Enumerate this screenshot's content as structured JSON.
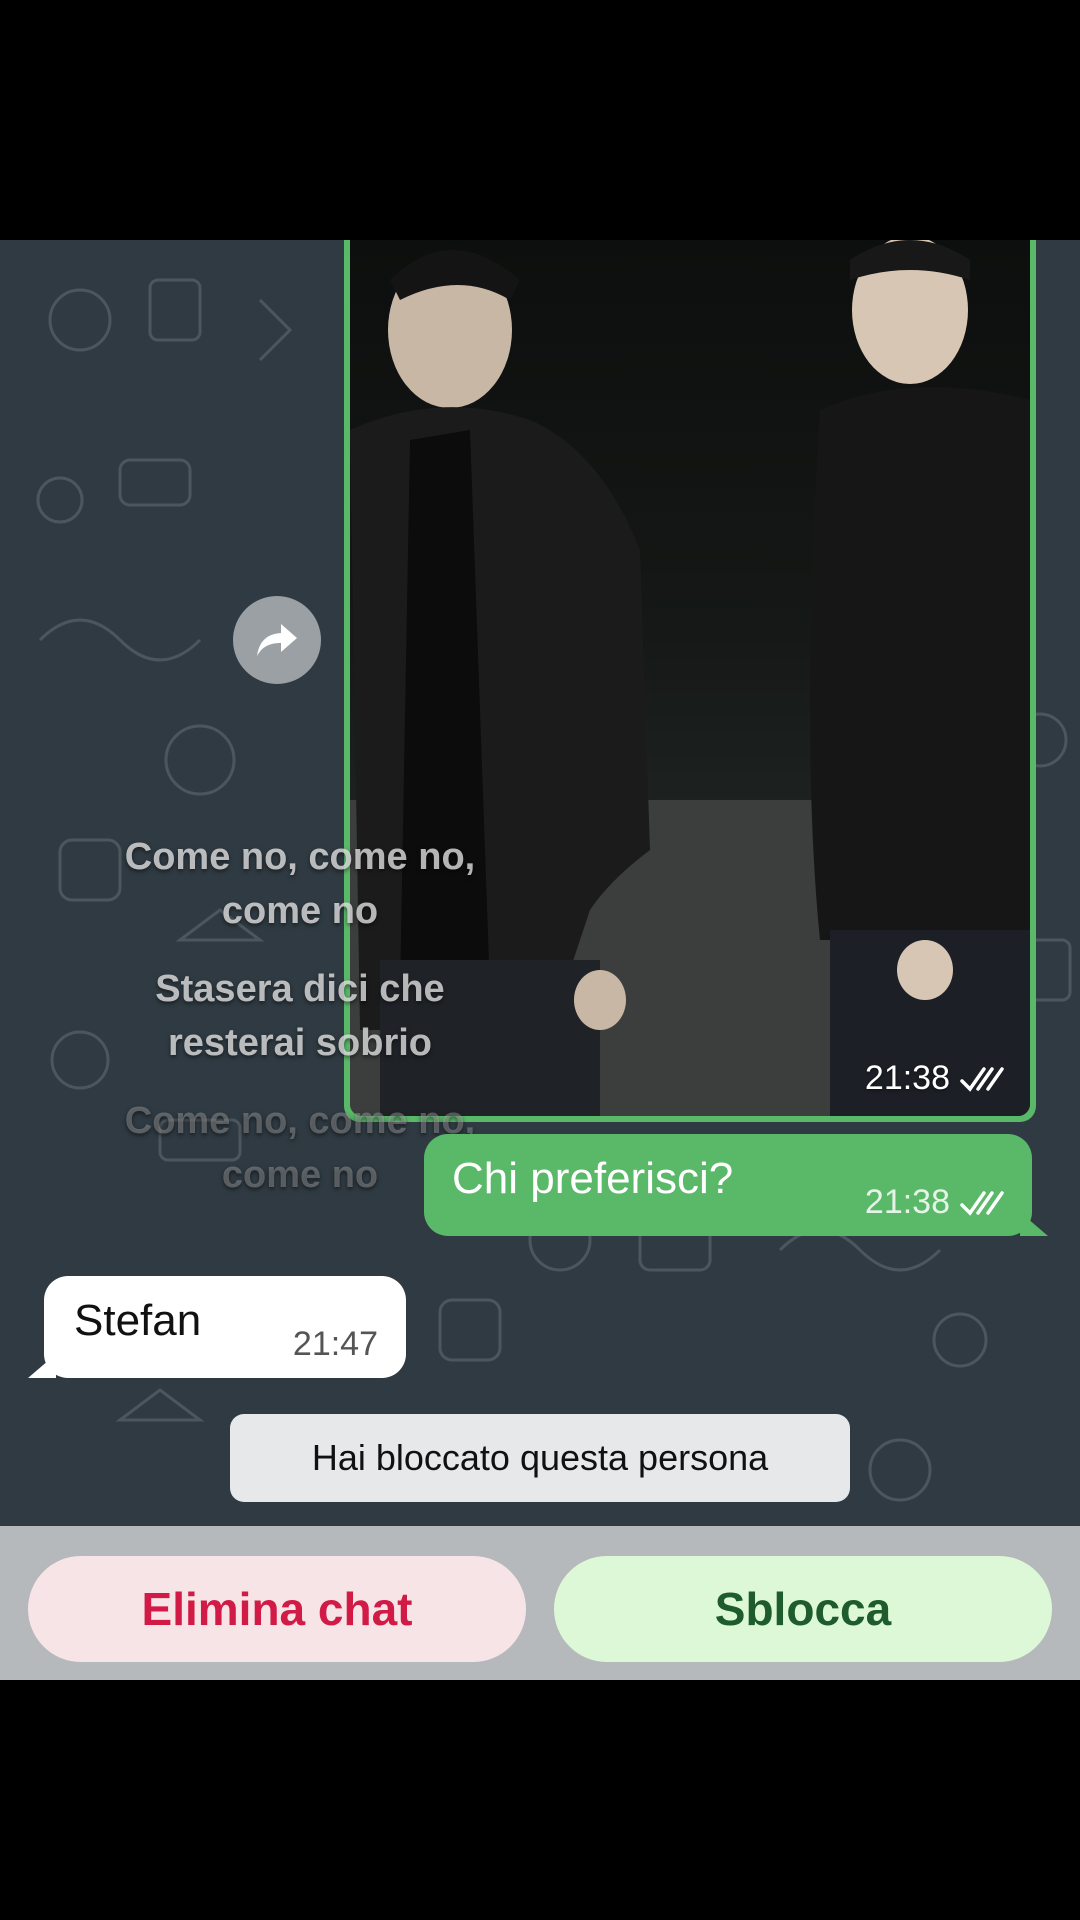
{
  "chat": {
    "photo_message": {
      "time": "21:38",
      "status": "read-double-check"
    },
    "lyrics_overlay": [
      "Come no, come no,",
      "come no",
      "Stasera dici che",
      "resterai sobrio",
      "Come no, come no,",
      "come no"
    ],
    "outgoing_message": {
      "text": "Chi preferisci?",
      "time": "21:38",
      "status": "read-double-check"
    },
    "incoming_message": {
      "text": "Stefan",
      "time": "21:47"
    },
    "system_notice": "Hai bloccato questa persona"
  },
  "actions": {
    "delete_label": "Elimina chat",
    "unblock_label": "Sblocca"
  },
  "icons": {
    "forward": "forward-arrow-icon",
    "ticks": "double-check-icon"
  },
  "colors": {
    "outgoing_bubble": "#5ab869",
    "incoming_bubble": "#ffffff",
    "chat_background": "#2f3a42",
    "delete_text": "#d11a45",
    "unblock_text": "#1e5b2d"
  }
}
